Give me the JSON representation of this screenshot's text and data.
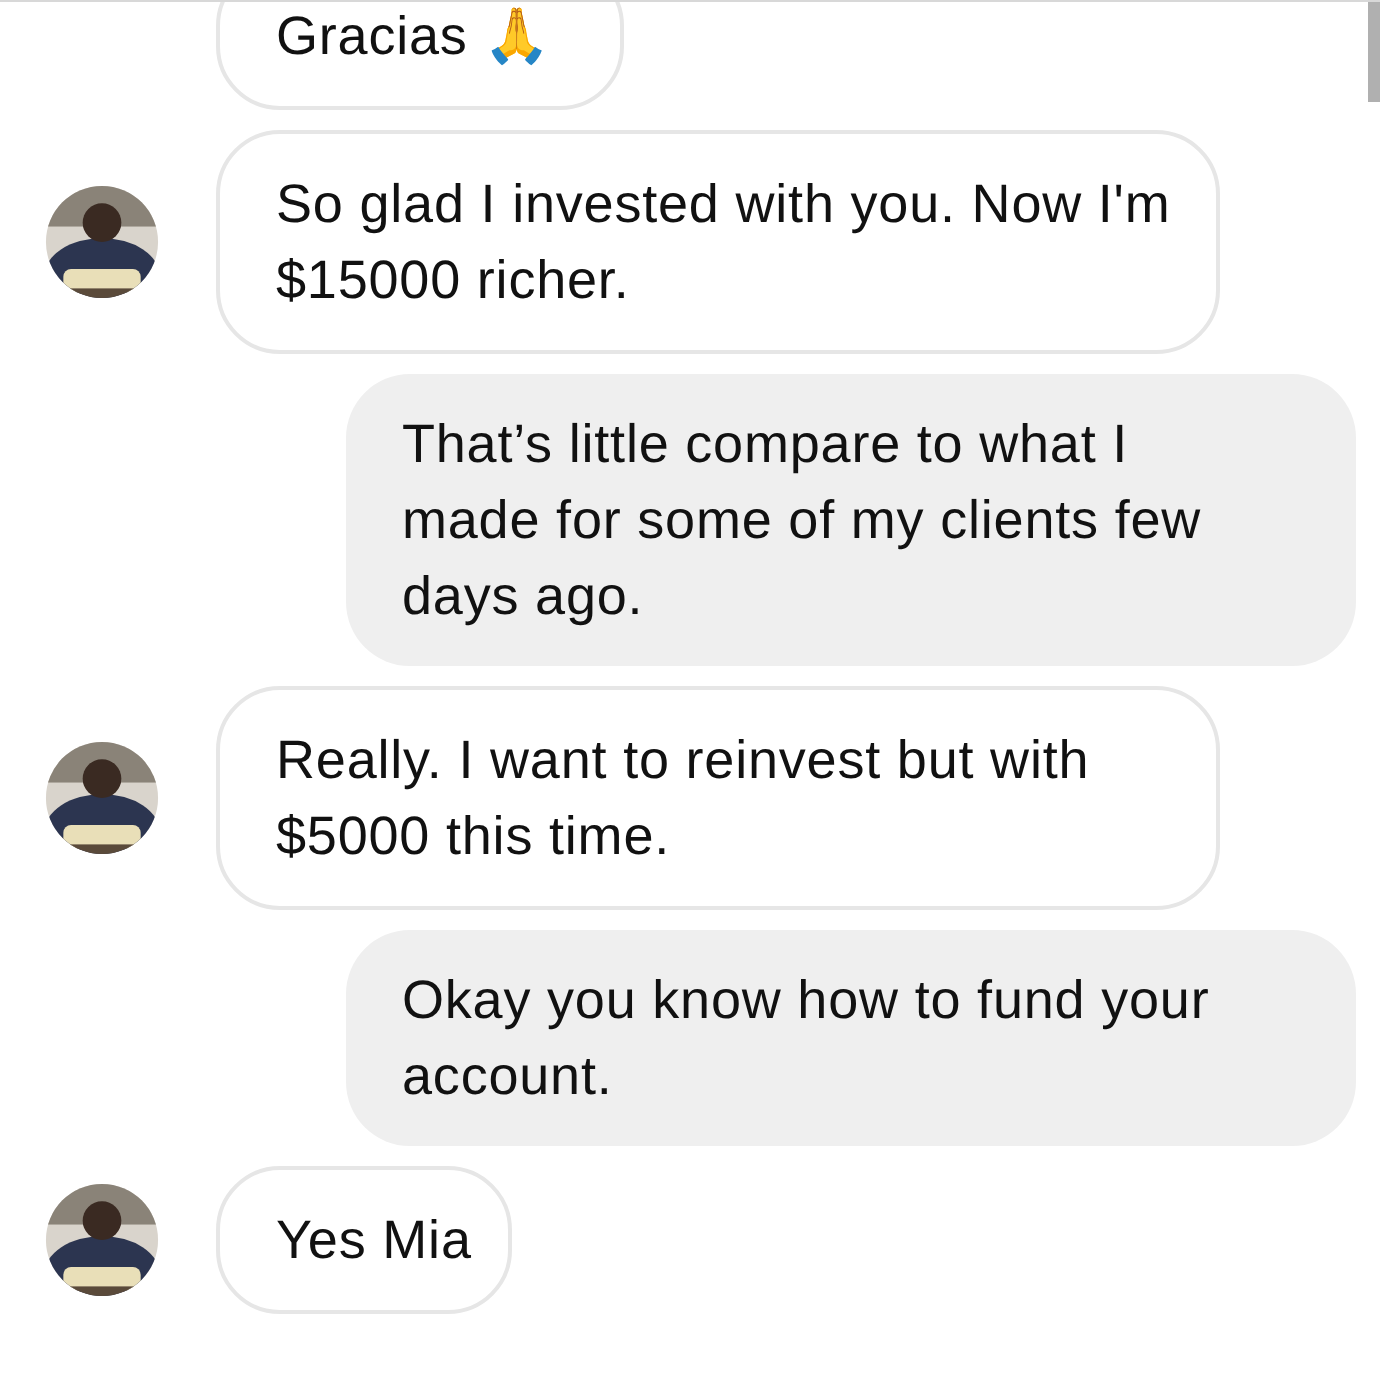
{
  "messages": [
    {
      "kind": "incoming",
      "avatar": false,
      "text": "Gracias 🙏"
    },
    {
      "kind": "incoming",
      "avatar": true,
      "text": "So glad I invested with you. Now I'm $15000 richer."
    },
    {
      "kind": "outgoing",
      "text": "That’s little compare to what I made for some of my clients few days ago."
    },
    {
      "kind": "incoming",
      "avatar": true,
      "text": "Really. I want to reinvest but with $5000 this time."
    },
    {
      "kind": "outgoing",
      "text": "Okay you know how to fund your account."
    },
    {
      "kind": "incoming",
      "avatar": true,
      "text": "Yes Mia"
    }
  ]
}
